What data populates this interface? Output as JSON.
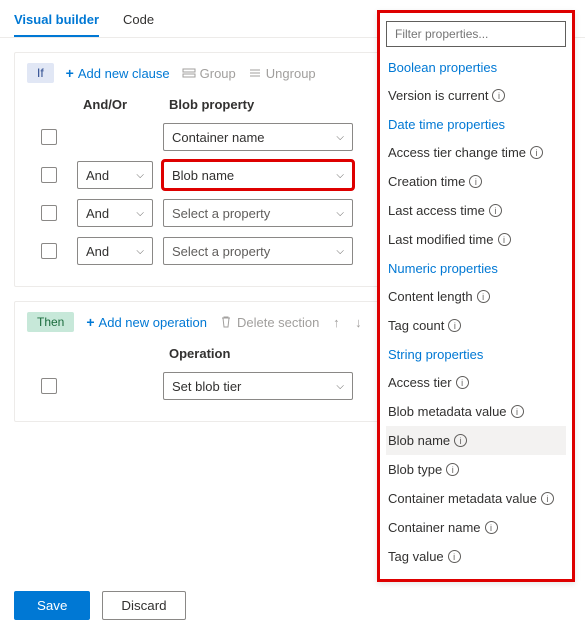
{
  "tabs": {
    "visual": "Visual builder",
    "code": "Code"
  },
  "if_panel": {
    "pill": "If",
    "add": "Add new clause",
    "group": "Group",
    "ungroup": "Ungroup",
    "headers": {
      "andor": "And/Or",
      "prop": "Blob property"
    },
    "rows": [
      {
        "andor": "",
        "prop": "Container name",
        "placeholder": false
      },
      {
        "andor": "And",
        "prop": "Blob name",
        "placeholder": false,
        "highlight": true
      },
      {
        "andor": "And",
        "prop": "Select a property",
        "placeholder": true
      },
      {
        "andor": "And",
        "prop": "Select a property",
        "placeholder": true
      }
    ]
  },
  "then_panel": {
    "pill": "Then",
    "add": "Add new operation",
    "delete": "Delete section",
    "headers": {
      "op": "Operation"
    },
    "rows": [
      {
        "op": "Set blob tier"
      }
    ]
  },
  "footer": {
    "save": "Save",
    "discard": "Discard"
  },
  "dropdown": {
    "filter_placeholder": "Filter properties...",
    "groups": [
      {
        "title": "Boolean properties",
        "items": [
          "Version is current"
        ]
      },
      {
        "title": "Date time properties",
        "items": [
          "Access tier change time",
          "Creation time",
          "Last access time",
          "Last modified time"
        ]
      },
      {
        "title": "Numeric properties",
        "items": [
          "Content length",
          "Tag count"
        ]
      },
      {
        "title": "String properties",
        "items": [
          "Access tier",
          "Blob metadata value",
          "Blob name",
          "Blob type",
          "Container metadata value",
          "Container name",
          "Tag value"
        ]
      }
    ],
    "hover_item": "Blob name"
  }
}
